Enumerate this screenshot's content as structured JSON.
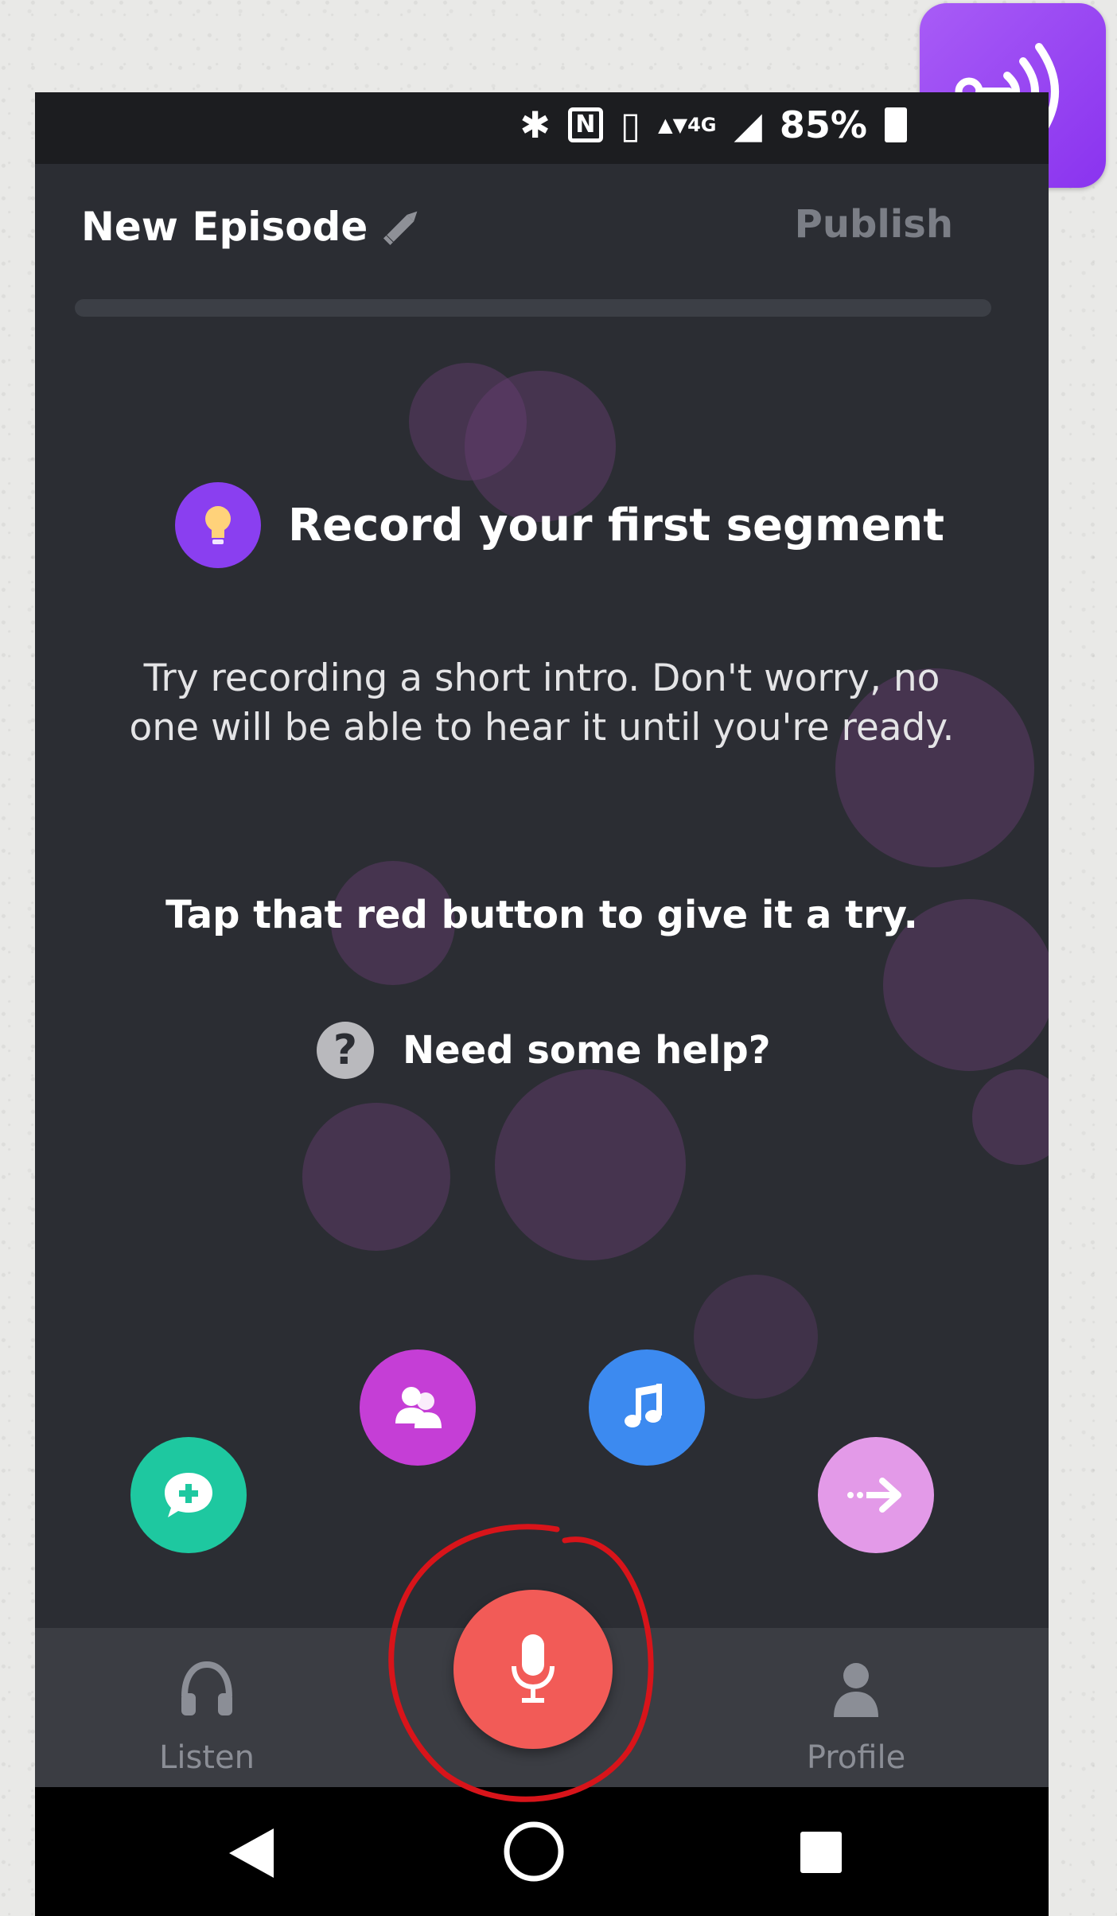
{
  "status_bar": {
    "bluetooth_icon": "bluetooth-icon",
    "nfc_icon": "nfc-icon",
    "vibrate_icon": "vibrate-icon",
    "network_label": "4G",
    "battery": "85%"
  },
  "header": {
    "title": "New Episode",
    "publish_label": "Publish"
  },
  "tip": {
    "title": "Record your first segment",
    "description": "Try recording a short intro. Don't worry, no one will be able to hear it until you're ready.",
    "tap_line": "Tap that red button to give it a try.",
    "help_label": "Need some help?",
    "help_glyph": "?"
  },
  "fabs": [
    {
      "name": "add-message-button",
      "icon": "message-plus-icon",
      "color": "#1ec8a0"
    },
    {
      "name": "interview-button",
      "icon": "people-icon",
      "color": "#c53ed6"
    },
    {
      "name": "music-button",
      "icon": "music-note-icon",
      "color": "#3c8af0"
    },
    {
      "name": "transition-button",
      "icon": "arrow-right-icon",
      "color": "#e39ae8"
    }
  ],
  "bottom_nav": {
    "listen_label": "Listen",
    "profile_label": "Profile",
    "record_icon": "microphone-icon"
  },
  "colors": {
    "accent_purple": "#8a3ff0",
    "record_red": "#f25b57",
    "background": "#2b2d33"
  }
}
